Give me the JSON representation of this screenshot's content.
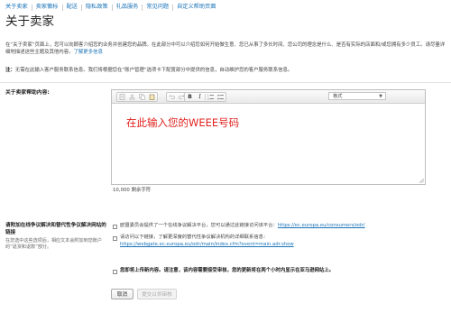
{
  "tabs": [
    {
      "label": "关于卖家"
    },
    {
      "label": "卖家徽标"
    },
    {
      "label": "配送"
    },
    {
      "label": "隐私政策"
    },
    {
      "label": "礼品服务"
    },
    {
      "label": "常见问题"
    },
    {
      "label": "自定义帮助页面"
    }
  ],
  "page": {
    "title": "关于卖家",
    "intro": "在“关于卖家”页面上，您可以向顾客介绍您的业务并创建您的品牌。在此部分中可以介绍您如何开始做生意、您已从事了多长时间、您公司的理念是什么、是否有实际的店面和/或您拥有多少员工。请尽量详细地描述这些主题及其他内容。",
    "intro_link": "了解更多信息",
    "note_label": "注：",
    "note_text": "无需在此输入客户服务联系信息。我们将根据您在“账户管理”选项卡下配置部分中提供的信息，自动维护您的客户服务联系信息。"
  },
  "about_field": {
    "label": "关于卖家帮助内容:",
    "format_label": "格式",
    "content": "在此输入您的WEEE号码",
    "char_count": "10,000 剩余字符"
  },
  "dispute": {
    "title": "请附加在线争议解决和替代性争议解决网站的链接",
    "help": "在您选中这些选项后，相应文本会附加到您账户的“退货和退款”部分。",
    "option1_text": "欧盟委员会提供了一个在线争议解决平台，您可以通过此链接访问该平台：",
    "option1_link": "https://ec.europa.eu/consumers/odr/",
    "option2_text": "请访问以下链接，了解更深度的替代性争议解决机构的详细联系信息：",
    "option2_link": "https://webgate.ec.europa.eu/odr/main/index.cfm?event=main.adr.show"
  },
  "confirm": {
    "text": "您即将上传新内容。请注意，该内容需要接受审核，您的更新将在两个小时内显示在亚马逊网站上。"
  },
  "buttons": {
    "cancel": "取消",
    "submit": "提交以供审核"
  }
}
